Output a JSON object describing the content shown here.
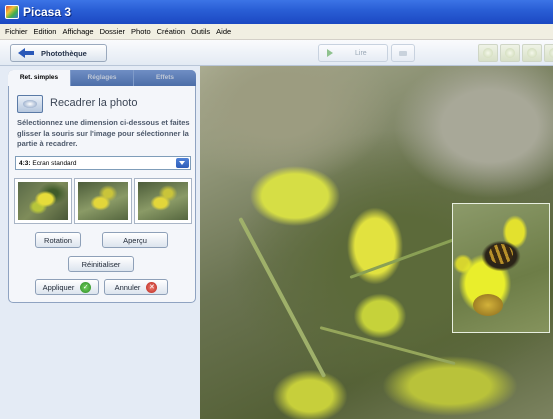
{
  "window": {
    "title": "Picasa 3"
  },
  "menu": [
    "Fichier",
    "Edition",
    "Affichage",
    "Dossier",
    "Photo",
    "Création",
    "Outils",
    "Aide"
  ],
  "toolbar": {
    "library_label": "Photothèque",
    "play_label": "Lire"
  },
  "tabs": [
    "Ret. simples",
    "Réglages",
    "Effets"
  ],
  "crop": {
    "heading": "Recadrer la photo",
    "description": "Sélectionnez une dimension ci-dessous et faites glisser la souris sur l'image pour sélectionner la partie à recadrer.",
    "ratio_prefix": "4:3:",
    "ratio_value": "Ecran standard"
  },
  "buttons": {
    "rotation": "Rotation",
    "preview": "Aperçu",
    "reset": "Réinitialiser",
    "apply": "Appliquer",
    "cancel": "Annuler"
  },
  "icons": {
    "app": "picasa-icon",
    "back": "back-arrow-icon",
    "play": "play-icon",
    "stop": "stop-icon",
    "crop": "crop-icon",
    "apply": "check-icon",
    "cancel": "cancel-icon"
  },
  "colors": {
    "titlebar": "#2a5fd6",
    "accent": "#4d6ea8",
    "apply_icon": "#2a8a22",
    "cancel_icon": "#b8231a"
  }
}
